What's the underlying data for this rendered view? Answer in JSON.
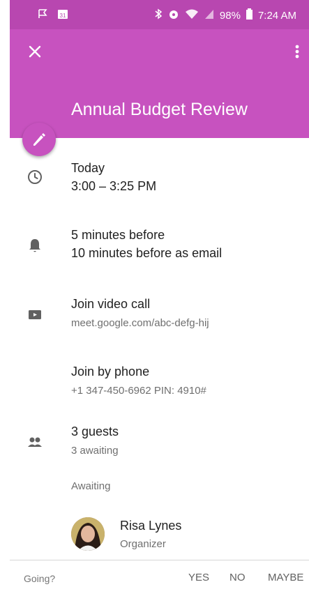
{
  "status_bar": {
    "battery": "98%",
    "time": "7:24 AM"
  },
  "event": {
    "title": "Annual Budget Review",
    "when_day": "Today",
    "when_time": "3:00 – 3:25 PM",
    "reminder_1": "5 minutes before",
    "reminder_2": "10 minutes before as email",
    "video_label": "Join video call",
    "video_link": "meet.google.com/abc-defg-hij",
    "phone_label": "Join by phone",
    "phone_details": "+1 347-450-6962 PIN: 4910#",
    "guests_count": "3 guests",
    "guests_status": "3 awaiting",
    "awaiting_heading": "Awaiting",
    "organizer_name": "Risa Lynes",
    "organizer_role": "Organizer"
  },
  "rsvp": {
    "prompt": "Going?",
    "yes": "YES",
    "no": "NO",
    "maybe": "MAYBE"
  },
  "colors": {
    "header": "#c752bf",
    "status_bar": "#b847b0",
    "icon_gray": "#616161"
  },
  "icons": [
    "close-icon",
    "more-vert-icon",
    "edit-pencil-icon",
    "clock-icon",
    "bell-icon",
    "video-camera-icon",
    "people-icon"
  ]
}
